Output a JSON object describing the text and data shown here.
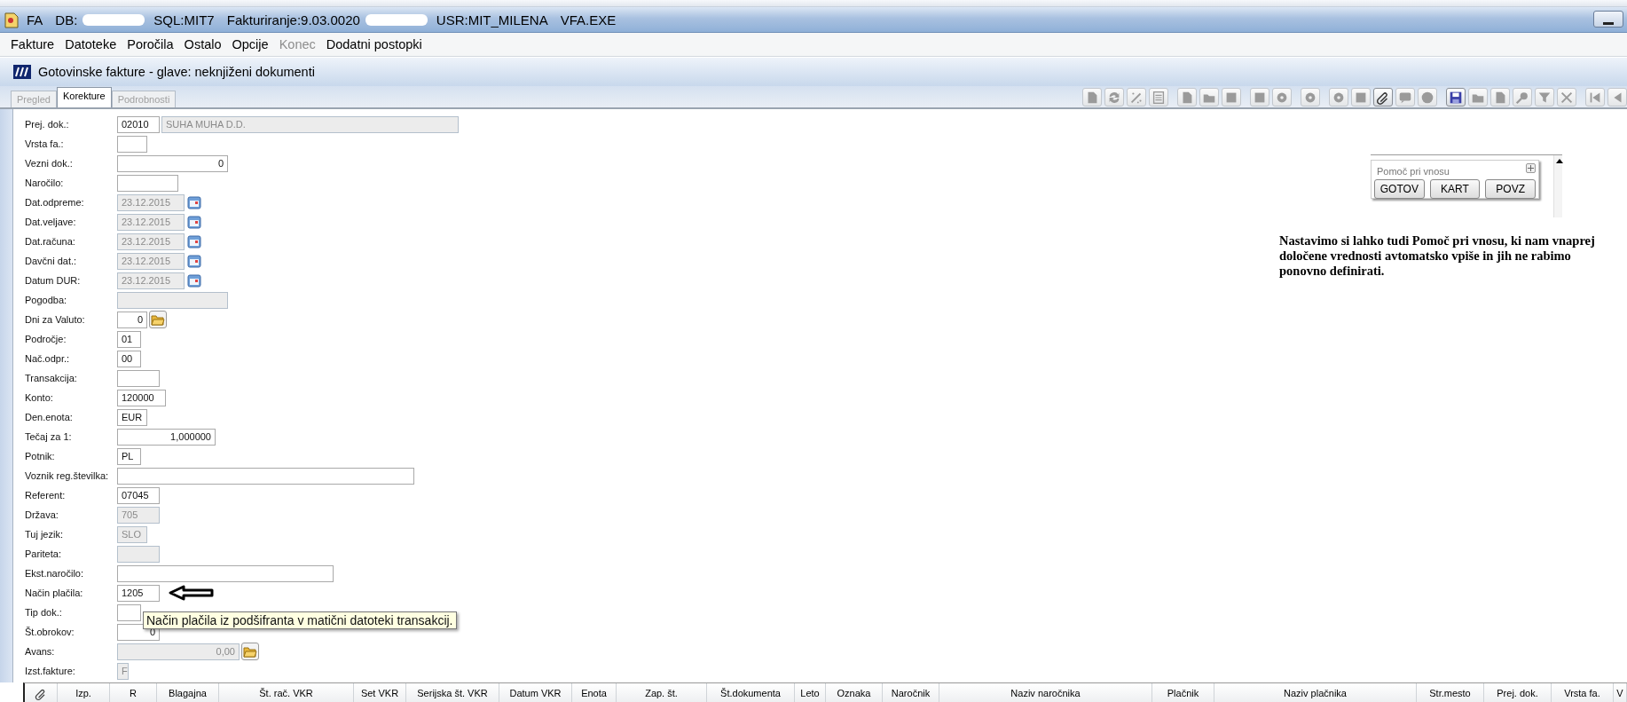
{
  "window": {
    "title_items": [
      "FA",
      "DB:",
      "SQL:MIT7",
      "Fakturiranje:9.03.0020",
      "USR:MIT_MILENA",
      "VFA.EXE"
    ]
  },
  "menu": [
    {
      "label": "Fakture",
      "disabled": false
    },
    {
      "label": "Datoteke",
      "disabled": false
    },
    {
      "label": "Poročila",
      "disabled": false
    },
    {
      "label": "Ostalo",
      "disabled": false
    },
    {
      "label": "Opcije",
      "disabled": false
    },
    {
      "label": "Konec",
      "disabled": true
    },
    {
      "label": "Dodatni postopki",
      "disabled": false
    }
  ],
  "document": {
    "title": "Gotovinske fakture - glave: neknjiženi dokumenti"
  },
  "tabs": [
    {
      "label": "Pregled",
      "selected": false,
      "disabled": true
    },
    {
      "label": "Korekture",
      "selected": true,
      "disabled": false
    },
    {
      "label": "Podrobnosti",
      "selected": false,
      "disabled": true
    }
  ],
  "toolbar": [
    [
      {
        "disabled": true
      },
      {
        "disabled": true
      },
      {
        "disabled": true
      },
      {
        "disabled": true
      }
    ],
    [
      {
        "disabled": true
      },
      {
        "disabled": true
      },
      {
        "disabled": true
      }
    ],
    [
      {
        "disabled": true
      },
      {
        "disabled": true
      }
    ],
    [
      {
        "disabled": true
      }
    ],
    [
      {
        "disabled": true
      },
      {
        "disabled": true
      },
      {
        "disabled": false
      },
      {
        "disabled": true
      },
      {
        "disabled": true
      }
    ],
    [
      {
        "disabled": false
      },
      {
        "disabled": true
      },
      {
        "disabled": true
      },
      {
        "disabled": true
      },
      {
        "disabled": true
      },
      {
        "disabled": true
      }
    ],
    [
      {
        "disabled": true
      },
      {
        "disabled": true
      }
    ]
  ],
  "form": {
    "fields": [
      {
        "label": "Prej. dok.:",
        "kind": "text",
        "value": "02010",
        "disabled": false,
        "partner": {
          "value": "SUHA MUHA D.D.",
          "disabled": true
        }
      },
      {
        "label": "Vrsta fa.:",
        "kind": "text",
        "disabled": false
      },
      {
        "label": "Vezni dok.:",
        "kind": "number",
        "value": "0",
        "disabled": false
      },
      {
        "label": "Naročilo:",
        "kind": "text",
        "disabled": false
      },
      {
        "label": "Dat.odpreme:",
        "kind": "date",
        "value": "23.12.2015",
        "disabled": true
      },
      {
        "label": "Dat.veljave:",
        "kind": "date",
        "value": "23.12.2015",
        "disabled": true
      },
      {
        "label": "Dat.računa:",
        "kind": "date",
        "value": "23.12.2015",
        "disabled": true
      },
      {
        "label": "Davčni dat.:",
        "kind": "date",
        "value": "23.12.2015",
        "disabled": true
      },
      {
        "label": "Datum DUR:",
        "kind": "date",
        "value": "23.12.2015",
        "disabled": true
      },
      {
        "label": "Pogodba:",
        "kind": "text",
        "disabled": true
      },
      {
        "label": "Dni za Valuto:",
        "kind": "number",
        "value": "0",
        "disabled": false,
        "lookup": true
      },
      {
        "label": "Področje:",
        "kind": "text",
        "value": "01",
        "disabled": false
      },
      {
        "label": "Nač.odpr.:",
        "kind": "text",
        "value": "00",
        "disabled": false
      },
      {
        "label": "Transakcija:",
        "kind": "text",
        "disabled": false
      },
      {
        "label": "Konto:",
        "kind": "text",
        "value": "120000",
        "disabled": false
      },
      {
        "label": "Den.enota:",
        "kind": "text",
        "value": "EUR",
        "disabled": false
      },
      {
        "label": "Tečaj za 1:",
        "kind": "number",
        "value": "1,000000",
        "disabled": false
      },
      {
        "label": "Potnik:",
        "kind": "text",
        "value": "PL",
        "disabled": false
      },
      {
        "label": "Voznik reg.številka:",
        "kind": "text",
        "disabled": false
      },
      {
        "label": "Referent:",
        "kind": "text",
        "value": "07045",
        "disabled": false
      },
      {
        "label": "Država:",
        "kind": "text",
        "value": "705",
        "disabled": true
      },
      {
        "label": "Tuj jezik:",
        "kind": "text",
        "value": "SLO",
        "disabled": true
      },
      {
        "label": "Pariteta:",
        "kind": "text",
        "disabled": true
      },
      {
        "label": "Ekst.naročilo:",
        "kind": "text",
        "disabled": false
      },
      {
        "label": "Način plačila:",
        "kind": "text",
        "value": "1205",
        "disabled": false,
        "pointer": true
      },
      {
        "label": "Tip dok.:",
        "kind": "text",
        "disabled": false
      },
      {
        "label": "Št.obrokov:",
        "kind": "number",
        "value": "0",
        "disabled": false
      },
      {
        "label": "Avans:",
        "kind": "number",
        "value": "0,00",
        "disabled": true,
        "lookup": true
      },
      {
        "label": "Izst.fakture:",
        "kind": "text",
        "value": "F",
        "disabled": true
      }
    ],
    "tooltip": "Način plačila iz podšifranta v matični datoteki transakcij."
  },
  "help_panel": {
    "title": "Pomoč pri vnosu",
    "buttons": [
      "GOTOV",
      "KART",
      "POVZ"
    ]
  },
  "note": "Nastavimo si lahko tudi Pomoč pri vnosu, ki nam vnaprej določene vrednosti avtomatsko vpiše in jih ne rabimo ponovno definirati.",
  "grid": {
    "columns": [
      "Izp.",
      "R",
      "Blagajna",
      "Št. rač. VKR",
      "Set VKR",
      "Serijska št. VKR",
      "Datum VKR",
      "Enota",
      "Zap. št.",
      "Št.dokumenta",
      "Leto",
      "Oznaka",
      "Naročnik",
      "Naziv naročnika",
      "Plačnik",
      "Naziv plačnika",
      "Str.mesto",
      "Prej. dok.",
      "Vrsta fa.",
      "V"
    ]
  }
}
